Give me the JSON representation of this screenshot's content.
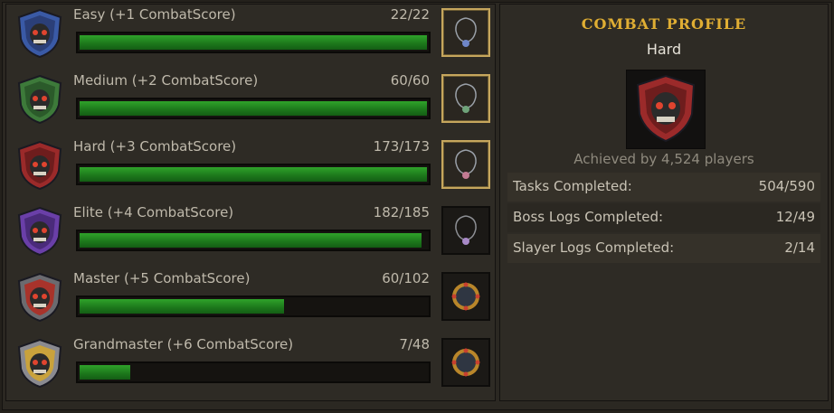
{
  "tiers": [
    {
      "name": "Easy (+1 CombatScore)",
      "count": "22/22",
      "progress": 1.0,
      "badge_color": "#3a5aa6",
      "reward": "amulet",
      "claimed": true
    },
    {
      "name": "Medium (+2 CombatScore)",
      "count": "60/60",
      "progress": 1.0,
      "badge_color": "#3d7a3a",
      "reward": "amulet",
      "claimed": true
    },
    {
      "name": "Hard (+3 CombatScore)",
      "count": "173/173",
      "progress": 1.0,
      "badge_color": "#9b2a2a",
      "reward": "amulet",
      "claimed": true
    },
    {
      "name": "Elite (+4 CombatScore)",
      "count": "182/185",
      "progress": 0.984,
      "badge_color": "#6a3fa8",
      "reward": "amulet",
      "claimed": false
    },
    {
      "name": "Master (+5 CombatScore)",
      "count": "60/102",
      "progress": 0.588,
      "badge_color": "#a8332b",
      "reward": "ring",
      "claimed": false
    },
    {
      "name": "Grandmaster (+6 CombatScore)",
      "count": "7/48",
      "progress": 0.146,
      "badge_color": "#c9a23c",
      "reward": "ring",
      "claimed": false
    }
  ],
  "profile": {
    "title": "COMBAT PROFILE",
    "tier": "Hard",
    "achieved": "Achieved by 4,524 players",
    "stats": [
      {
        "label": "Tasks Completed:",
        "value": "504/590"
      },
      {
        "label": "Boss Logs Completed:",
        "value": "12/49"
      },
      {
        "label": "Slayer Logs Completed:",
        "value": "2/14"
      }
    ]
  },
  "colors": {
    "bar_fill": "#1f8a1d",
    "title_gold": "#e0ae33",
    "claimed_border": "#c6a65d"
  }
}
